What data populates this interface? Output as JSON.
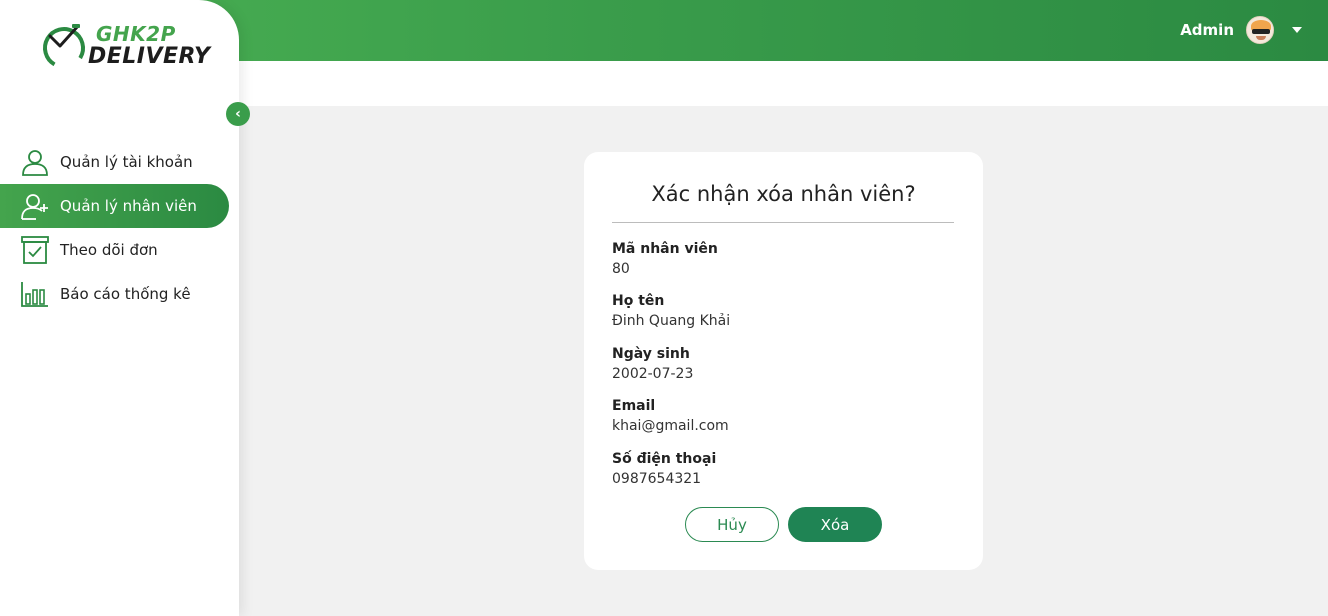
{
  "header": {
    "user_name": "Admin",
    "user_avatar_icon": "avatar-cat-sunglasses",
    "menu_icon": "chevron-down-icon",
    "gradient_start": "#4bb153",
    "gradient_end": "#2b8a42"
  },
  "brand": {
    "line1": "GHK2P",
    "line2": "DELIVERY",
    "accent": "#44a44d"
  },
  "sidebar": {
    "collapse_icon": "chevron-left-icon",
    "items": [
      {
        "label": "Quản lý tài khoản",
        "icon": "user-icon",
        "active": false
      },
      {
        "label": "Quản lý nhân viên",
        "icon": "user-add-icon",
        "active": true
      },
      {
        "label": "Theo dõi đơn",
        "icon": "order-check-icon",
        "active": false
      },
      {
        "label": "Báo cáo thống kê",
        "icon": "bar-chart-icon",
        "active": false
      }
    ]
  },
  "dialog": {
    "title": "Xác nhận xóa nhân viên?",
    "fields": [
      {
        "label": "Mã nhân viên",
        "value": "80"
      },
      {
        "label": "Họ tên",
        "value": "Đinh Quang Khải"
      },
      {
        "label": "Ngày sinh",
        "value": "2002-07-23"
      },
      {
        "label": "Email",
        "value": "khai@gmail.com"
      },
      {
        "label": "Số điện thoại",
        "value": "0987654321"
      }
    ],
    "cancel_label": "Hủy",
    "delete_label": "Xóa",
    "primary_color": "#1f8454"
  }
}
